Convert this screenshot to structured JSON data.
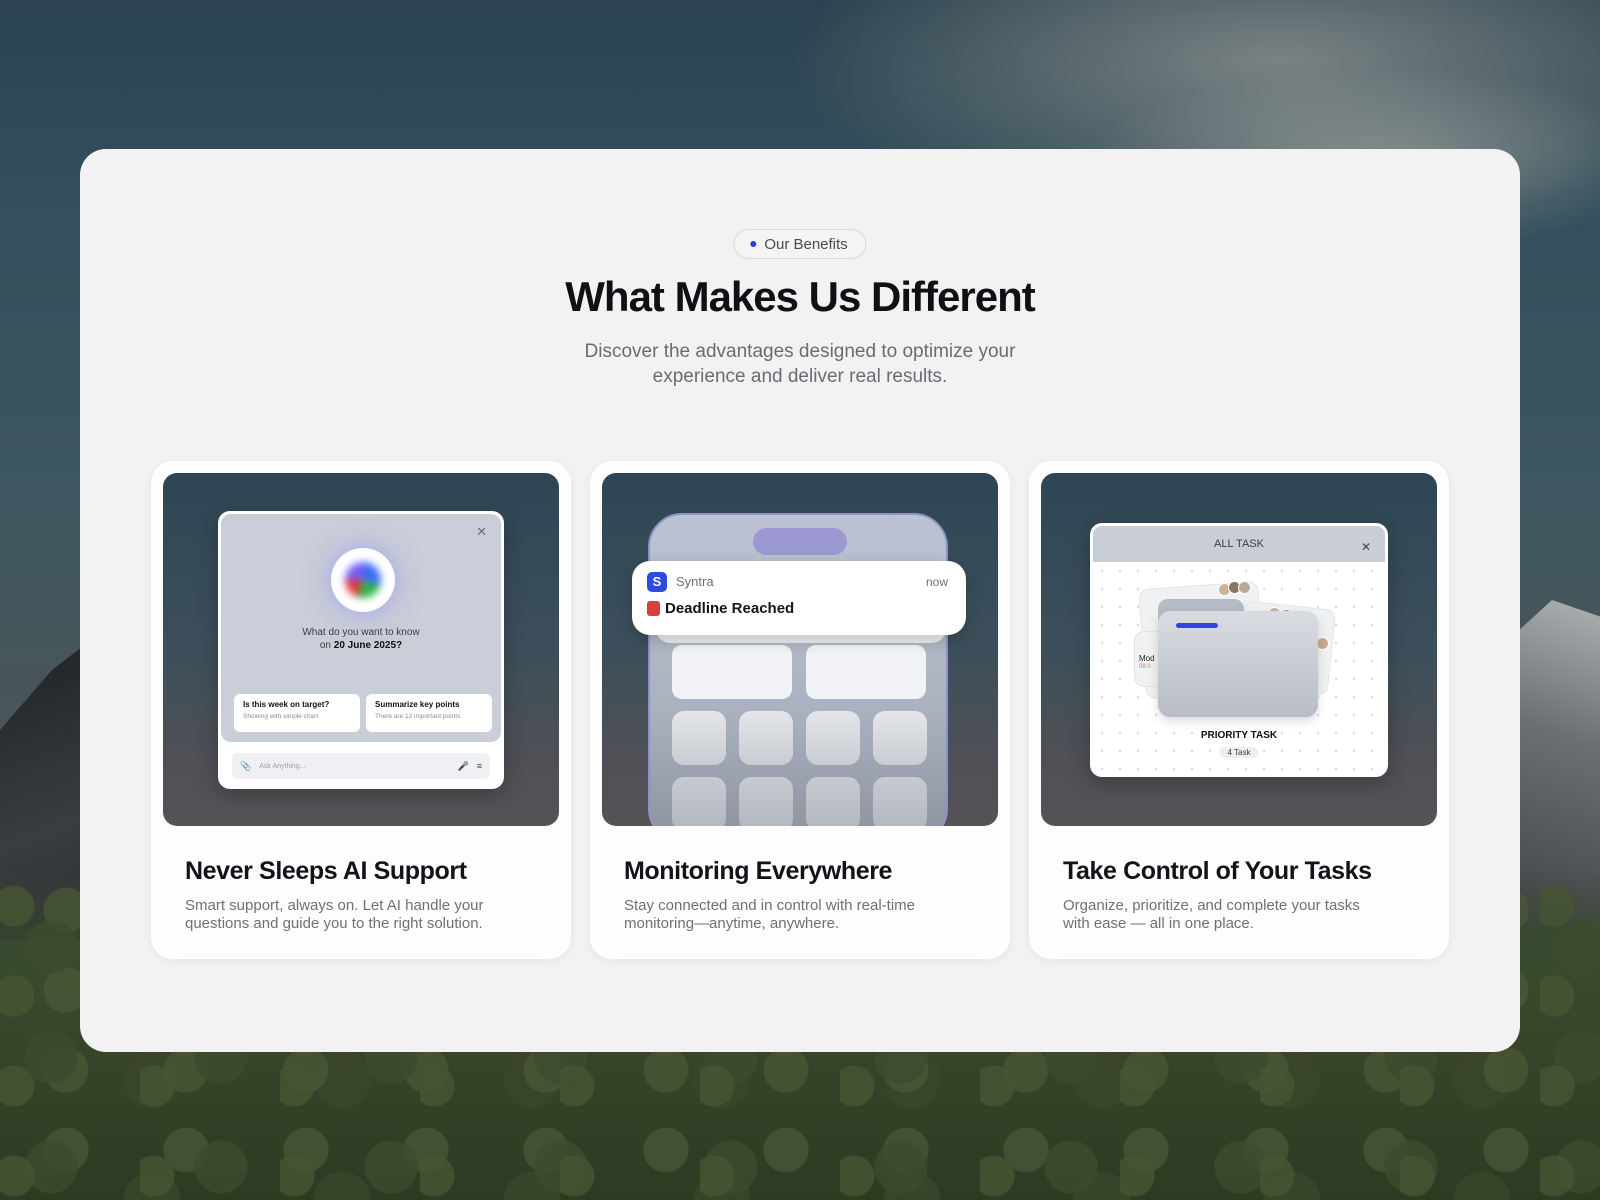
{
  "section": {
    "badge": "Our Benefits",
    "headline": "What Makes Us Different",
    "subline": "Discover the advantages designed to optimize your experience and deliver real results."
  },
  "cards": [
    {
      "title": "Never Sleeps AI Support",
      "desc": "Smart support, always on. Let AI handle your questions and guide you to the right solution.",
      "mock": {
        "question_line1": "What do you want to know",
        "question_prefix": "on",
        "question_date": "20 June 2025?",
        "suggestions": [
          {
            "title": "Is this week on target?",
            "sub": "Showing with simple chart"
          },
          {
            "title": "Summarize key points",
            "sub": "There are 12 important points"
          }
        ],
        "input_placeholder": "Ask Anything...",
        "close": "✕"
      }
    },
    {
      "title": "Monitoring Everywhere",
      "desc": "Stay connected and in control with real-time monitoring—anytime, anywhere.",
      "mock": {
        "app_initial": "S",
        "app_name": "Syntra",
        "time": "now",
        "message": "Deadline Reached"
      }
    },
    {
      "title": "Take Control of Your Tasks",
      "desc": "Organize, prioritize, and complete your tasks with ease — all in one place.",
      "mock": {
        "header": "ALL TASK",
        "close": "✕",
        "peek_label": "Mod",
        "peek_date": "08.0",
        "folder_title": "PRIORITY TASK",
        "folder_count": "4 Task"
      }
    }
  ],
  "colors": {
    "accent": "#2f4ae0",
    "panel_bg": "#f2f2f2",
    "alarm": "#d6403c"
  }
}
